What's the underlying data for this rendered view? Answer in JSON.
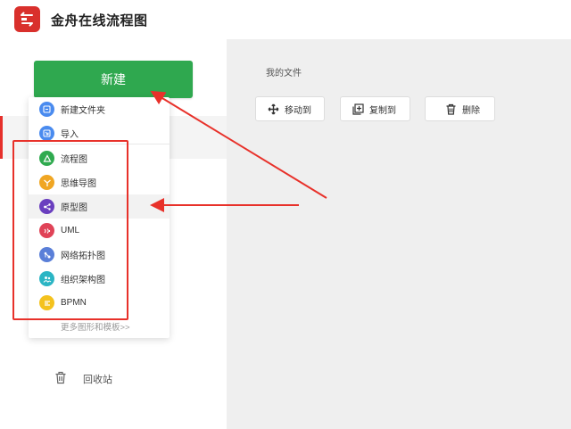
{
  "header": {
    "app_title": "金舟在线流程图"
  },
  "sidebar": {
    "new_button_label": "新建",
    "recycle_bin_label": "回收站"
  },
  "dropdown": {
    "top_items": [
      {
        "label": "新建文件夹",
        "icon": "new-folder-icon",
        "color": "#4a8bef"
      },
      {
        "label": "导入",
        "icon": "import-icon",
        "color": "#4a8bef"
      }
    ],
    "chart_items": [
      {
        "label": "流程图",
        "icon": "flowchart-icon",
        "color": "#2faa4f"
      },
      {
        "label": "思维导图",
        "icon": "mindmap-icon",
        "color": "#f0a623"
      },
      {
        "label": "原型图",
        "icon": "prototype-icon",
        "color": "#6a3fbf"
      },
      {
        "label": "UML",
        "icon": "uml-icon",
        "color": "#e04357"
      },
      {
        "label": "网络拓扑图",
        "icon": "network-topology-icon",
        "color": "#5a7fd8"
      },
      {
        "label": "组织架构图",
        "icon": "org-chart-icon",
        "color": "#2bb5c4"
      },
      {
        "label": "BPMN",
        "icon": "bpmn-icon",
        "color": "#f4c21e"
      }
    ],
    "more_link": "更多图形和模板>>"
  },
  "main": {
    "breadcrumb": "我的文件",
    "actions": [
      {
        "label": "移动到",
        "icon": "move-icon"
      },
      {
        "label": "复制到",
        "icon": "copy-icon"
      },
      {
        "label": "删除",
        "icon": "trash-icon"
      }
    ]
  },
  "colors": {
    "brand_red": "#d9302c",
    "new_button_green": "#2fa84f",
    "annotation_red": "#e8312a",
    "main_bg": "#efefef"
  }
}
